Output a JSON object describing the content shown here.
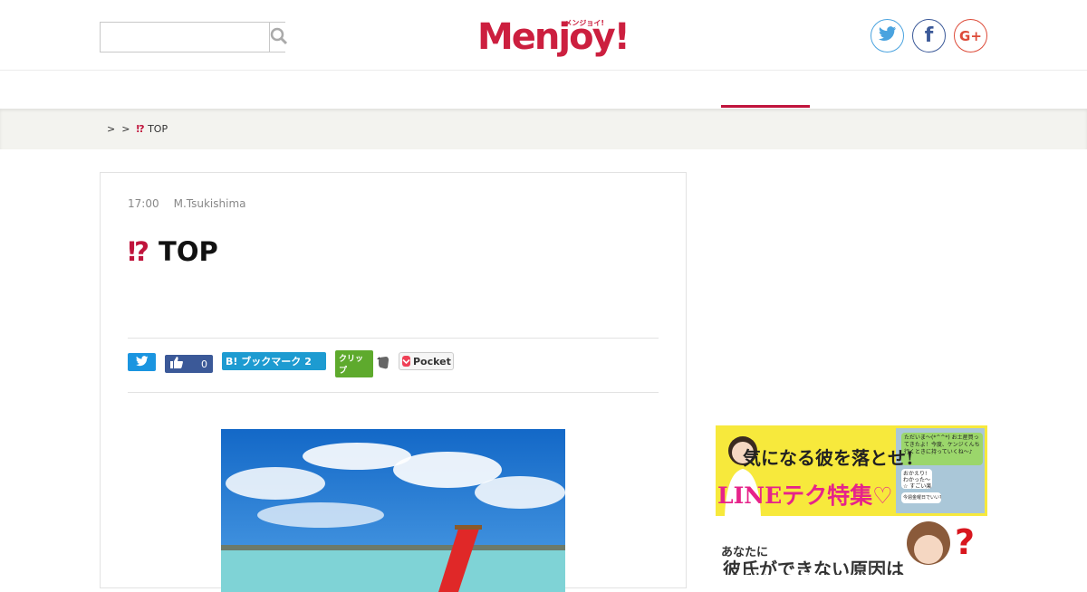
{
  "header": {
    "search": {
      "placeholder": "",
      "value": ""
    },
    "logo": {
      "text": "Menjoy!",
      "subtitle": "メンジョイ!"
    },
    "social": {
      "twitter_icon": "twitter-bird",
      "facebook_label": "f",
      "googleplus_label": "G+"
    }
  },
  "colors": {
    "accent": "#c0143c",
    "twitter": "#4aa3df",
    "facebook": "#3b5998",
    "googleplus": "#dd4b39",
    "breadcrumb_bg": "#f3f3ef"
  },
  "breadcrumb": {
    "sep1": ">",
    "sep2": ">",
    "mark": "⁉",
    "current": "TOP"
  },
  "article": {
    "time": "17:00",
    "author": "M.Tsukishima",
    "title_mark": "⁉",
    "title": "TOP",
    "share": {
      "like_count": "0",
      "hatena_label": "B! ブックマーク",
      "hatena_count": "2",
      "clip_label": "クリップ",
      "pocket_label": "Pocket"
    }
  },
  "sidebar": {
    "banner1": {
      "line1": "気になる彼を落とせ!",
      "line2": "LINEテク特集♡",
      "chat1": "ただいま〜(*^^*) お土産買ってきたよ！今度、ケンジくんち行くときに持っていくね〜♪",
      "chat2": "おかえり! わかった〜☆ すごい楽しみ♪",
      "chat3": "今週金曜日でいい?"
    },
    "banner2": {
      "line1": "あなたに",
      "line2": "彼氏ができない原因は",
      "mark": "?"
    }
  }
}
